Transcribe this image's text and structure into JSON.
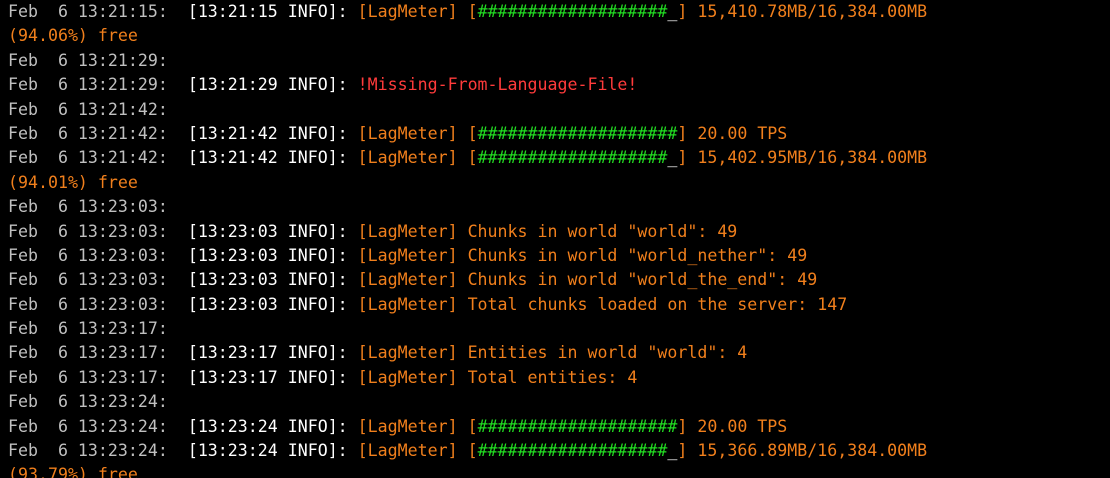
{
  "colors": {
    "background": "#000000",
    "timestamp": "#c0c0c0",
    "bracket_info": "#ffffff",
    "plugin_orange": "#f07f1c",
    "bar_green": "#22dd22",
    "error_red": "#ff3b3b"
  },
  "lines": [
    {
      "segs": [
        {
          "t": "Feb  6 13:21:15:  ",
          "c": "timestamp"
        },
        {
          "t": "[13:21:15 INFO]: ",
          "c": "bracket_info"
        },
        {
          "t": "[LagMeter] [",
          "c": "plugin_orange"
        },
        {
          "t": "###################",
          "c": "bar_green"
        },
        {
          "t": "_",
          "c": "bracket_info"
        },
        {
          "t": "] 15,410.78MB/16,384.00MB",
          "c": "plugin_orange"
        }
      ]
    },
    {
      "segs": [
        {
          "t": "(94.06%) free",
          "c": "plugin_orange"
        }
      ]
    },
    {
      "segs": [
        {
          "t": "Feb  6 13:21:29:",
          "c": "timestamp"
        }
      ]
    },
    {
      "segs": [
        {
          "t": "Feb  6 13:21:29:  ",
          "c": "timestamp"
        },
        {
          "t": "[13:21:29 INFO]: ",
          "c": "bracket_info"
        },
        {
          "t": "!Missing-From-Language-File!",
          "c": "error_red"
        }
      ]
    },
    {
      "segs": [
        {
          "t": "Feb  6 13:21:42:",
          "c": "timestamp"
        }
      ]
    },
    {
      "segs": [
        {
          "t": "Feb  6 13:21:42:  ",
          "c": "timestamp"
        },
        {
          "t": "[13:21:42 INFO]: ",
          "c": "bracket_info"
        },
        {
          "t": "[LagMeter] [",
          "c": "plugin_orange"
        },
        {
          "t": "####################",
          "c": "bar_green"
        },
        {
          "t": "] 20.00 TPS",
          "c": "plugin_orange"
        }
      ]
    },
    {
      "segs": [
        {
          "t": "Feb  6 13:21:42:  ",
          "c": "timestamp"
        },
        {
          "t": "[13:21:42 INFO]: ",
          "c": "bracket_info"
        },
        {
          "t": "[LagMeter] [",
          "c": "plugin_orange"
        },
        {
          "t": "###################",
          "c": "bar_green"
        },
        {
          "t": "_",
          "c": "bracket_info"
        },
        {
          "t": "] 15,402.95MB/16,384.00MB",
          "c": "plugin_orange"
        }
      ]
    },
    {
      "segs": [
        {
          "t": "(94.01%) free",
          "c": "plugin_orange"
        }
      ]
    },
    {
      "segs": [
        {
          "t": "Feb  6 13:23:03:",
          "c": "timestamp"
        }
      ]
    },
    {
      "segs": [
        {
          "t": "Feb  6 13:23:03:  ",
          "c": "timestamp"
        },
        {
          "t": "[13:23:03 INFO]: ",
          "c": "bracket_info"
        },
        {
          "t": "[LagMeter] Chunks in world \"world\": 49",
          "c": "plugin_orange"
        }
      ]
    },
    {
      "segs": [
        {
          "t": "Feb  6 13:23:03:  ",
          "c": "timestamp"
        },
        {
          "t": "[13:23:03 INFO]: ",
          "c": "bracket_info"
        },
        {
          "t": "[LagMeter] Chunks in world \"world_nether\": 49",
          "c": "plugin_orange"
        }
      ]
    },
    {
      "segs": [
        {
          "t": "Feb  6 13:23:03:  ",
          "c": "timestamp"
        },
        {
          "t": "[13:23:03 INFO]: ",
          "c": "bracket_info"
        },
        {
          "t": "[LagMeter] Chunks in world \"world_the_end\": 49",
          "c": "plugin_orange"
        }
      ]
    },
    {
      "segs": [
        {
          "t": "Feb  6 13:23:03:  ",
          "c": "timestamp"
        },
        {
          "t": "[13:23:03 INFO]: ",
          "c": "bracket_info"
        },
        {
          "t": "[LagMeter] Total chunks loaded on the server: 147",
          "c": "plugin_orange"
        }
      ]
    },
    {
      "segs": [
        {
          "t": "Feb  6 13:23:17:",
          "c": "timestamp"
        }
      ]
    },
    {
      "segs": [
        {
          "t": "Feb  6 13:23:17:  ",
          "c": "timestamp"
        },
        {
          "t": "[13:23:17 INFO]: ",
          "c": "bracket_info"
        },
        {
          "t": "[LagMeter] Entities in world \"world\": 4",
          "c": "plugin_orange"
        }
      ]
    },
    {
      "segs": [
        {
          "t": "Feb  6 13:23:17:  ",
          "c": "timestamp"
        },
        {
          "t": "[13:23:17 INFO]: ",
          "c": "bracket_info"
        },
        {
          "t": "[LagMeter] Total entities: 4",
          "c": "plugin_orange"
        }
      ]
    },
    {
      "segs": [
        {
          "t": "Feb  6 13:23:24:",
          "c": "timestamp"
        }
      ]
    },
    {
      "segs": [
        {
          "t": "Feb  6 13:23:24:  ",
          "c": "timestamp"
        },
        {
          "t": "[13:23:24 INFO]: ",
          "c": "bracket_info"
        },
        {
          "t": "[LagMeter] [",
          "c": "plugin_orange"
        },
        {
          "t": "####################",
          "c": "bar_green"
        },
        {
          "t": "] 20.00 TPS",
          "c": "plugin_orange"
        }
      ]
    },
    {
      "segs": [
        {
          "t": "Feb  6 13:23:24:  ",
          "c": "timestamp"
        },
        {
          "t": "[13:23:24 INFO]: ",
          "c": "bracket_info"
        },
        {
          "t": "[LagMeter] [",
          "c": "plugin_orange"
        },
        {
          "t": "###################",
          "c": "bar_green"
        },
        {
          "t": "_",
          "c": "bracket_info"
        },
        {
          "t": "] 15,366.89MB/16,384.00MB",
          "c": "plugin_orange"
        }
      ]
    },
    {
      "segs": [
        {
          "t": "(93.79%) free",
          "c": "plugin_orange"
        }
      ]
    }
  ]
}
